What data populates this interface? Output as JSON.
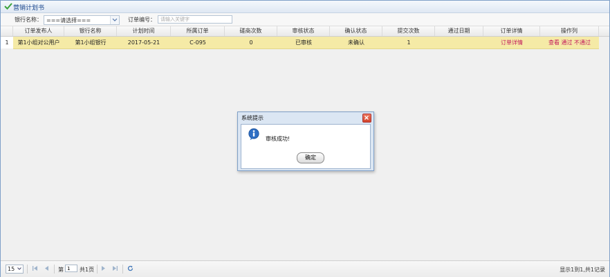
{
  "window": {
    "title": "营销计划书"
  },
  "filters": {
    "bank_label": "银行名称：",
    "bank_value": "===请选择===",
    "order_label": "订单编号：",
    "order_placeholder": "请输入关键字"
  },
  "table": {
    "columns": [
      "订单发布人",
      "银行名称",
      "计划时间",
      "所属订单",
      "磋商次数",
      "审核状态",
      "确认状态",
      "提交次数",
      "通过日期",
      "订单详情",
      "操作列"
    ],
    "rows": [
      {
        "num": "1",
        "publisher": "第1小组对公用户",
        "bank": "第1小组银行",
        "plan_time": "2017-05-21",
        "order": "C-095",
        "negotiations": "0",
        "audit_status": "已审核",
        "confirm_status": "未确认",
        "submissions": "1",
        "pass_date": "",
        "detail_link": "订单详情",
        "actions": {
          "view": "查看",
          "pass": "通过",
          "reject": "不通过"
        }
      }
    ]
  },
  "pager": {
    "page_size": "15",
    "page_prefix": "第",
    "page_value": "1",
    "page_total": "共1页",
    "summary": "显示1到1,共1记录"
  },
  "dialog": {
    "title": "系统提示",
    "message": "审核成功!",
    "ok_label": "确定"
  },
  "colors": {
    "row_selected": "#f5eaa6",
    "link": "#c2185b",
    "title_text": "#15428b"
  }
}
